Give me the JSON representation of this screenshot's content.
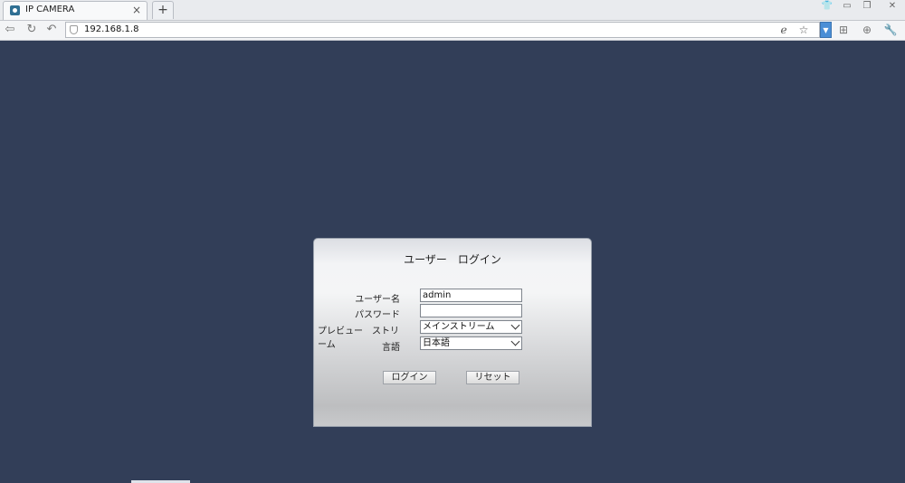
{
  "browser": {
    "tab_title": "IP CAMERA",
    "tab_close": "×",
    "new_tab": "+",
    "address": "192.168.1.8"
  },
  "login": {
    "title": "ユーザー　ログイン",
    "username_label": "ユーザー名",
    "username_value": "admin",
    "password_label": "パスワード",
    "password_value": "",
    "stream_label": "プレビュー　ストリーム",
    "stream_value": "メインストリーム",
    "language_label": "言語",
    "language_value": "日本語",
    "login_button": "ログイン",
    "reset_button": "リセット"
  },
  "colors": {
    "background": "#323e58",
    "accent": "#4a8ed6"
  }
}
